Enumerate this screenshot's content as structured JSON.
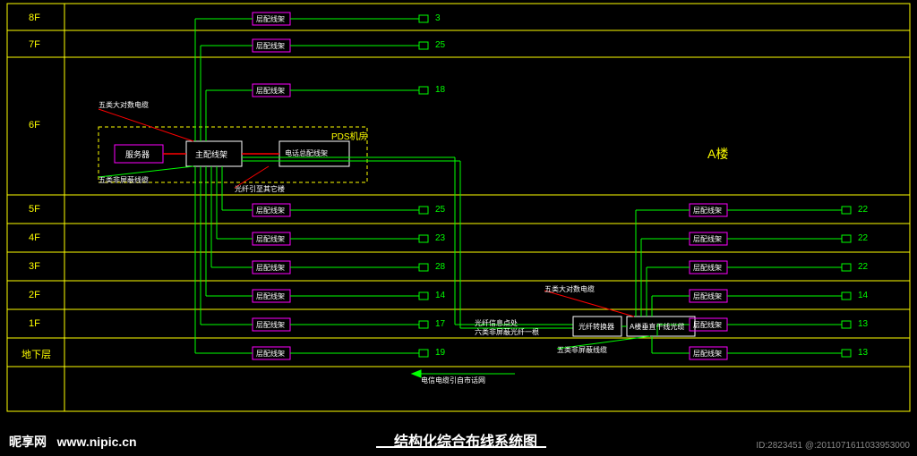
{
  "title": "结构化综合布线系统图",
  "building_label": "A楼",
  "watermark": {
    "site_cn": "昵享网",
    "site_url": "www.nipic.cn",
    "id": "ID:2823451 @:2011071611033953000"
  },
  "machine_room": {
    "title": "PDS机房",
    "server": "服务器",
    "main_patch": "主配线架",
    "phone_patch": "电话总配线架"
  },
  "cable_notes": {
    "cat5_pair": "五类大对数电缆",
    "cat5_unshield": "五类非屏蔽线缆",
    "optical_to_building": "光纤引至其它楼",
    "telecom_net": "电信电缆引自市话网",
    "optical_midspan": "光纤信息点处",
    "cat5_midspan": "六类非屏蔽光纤一根"
  },
  "optical_box": {
    "converter": "光纤转换器",
    "vertical": "A楼垂直干线光缆"
  },
  "left": {
    "floors": [
      {
        "name": "8F",
        "patch": "层配线架",
        "count": "3"
      },
      {
        "name": "7F",
        "patch": "层配线架",
        "count": "25"
      },
      {
        "name": "6F",
        "patch": "层配线架",
        "count": "18"
      },
      {
        "name": "5F",
        "patch": "层配线架",
        "count": "25"
      },
      {
        "name": "4F",
        "patch": "层配线架",
        "count": "23"
      },
      {
        "name": "3F",
        "patch": "层配线架",
        "count": "28"
      },
      {
        "name": "2F",
        "patch": "层配线架",
        "count": "14"
      },
      {
        "name": "1F",
        "patch": "层配线架",
        "count": "17"
      },
      {
        "name": "地下层",
        "patch": "层配线架",
        "count": "19"
      }
    ]
  },
  "right": {
    "floors": [
      {
        "name": "5F",
        "patch": "层配线架",
        "count": "22"
      },
      {
        "name": "4F",
        "patch": "层配线架",
        "count": "22"
      },
      {
        "name": "3F",
        "patch": "层配线架",
        "count": "22"
      },
      {
        "name": "2F",
        "patch": "层配线架",
        "count": "14"
      },
      {
        "name": "1F",
        "patch": "层配线架",
        "count": "13"
      },
      {
        "name": "地下层",
        "patch": "层配线架",
        "count": "13"
      }
    ]
  }
}
